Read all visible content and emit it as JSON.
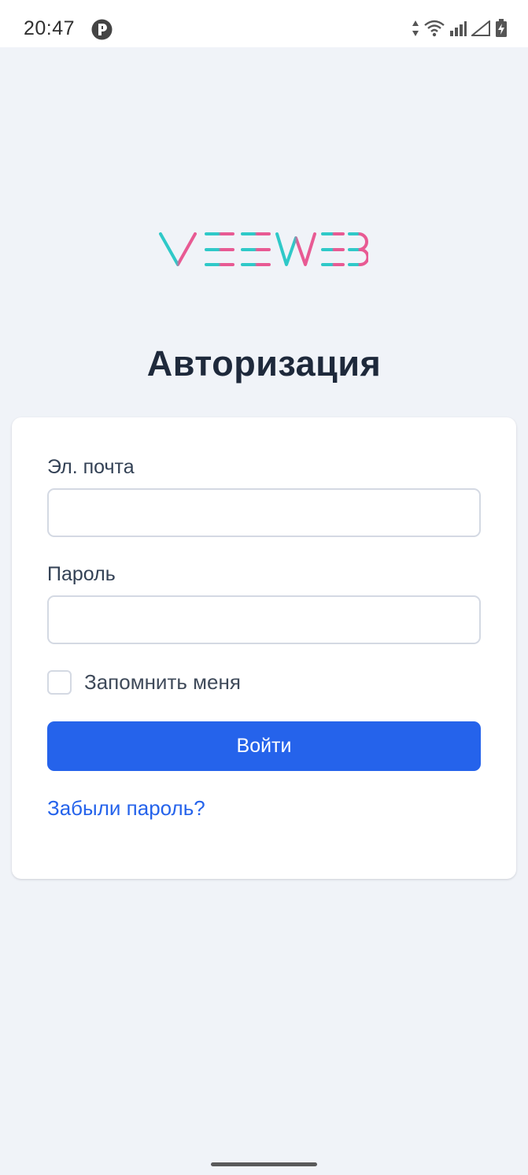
{
  "status_bar": {
    "time": "20:47",
    "app_icon": "pocket-p-icon",
    "icons": [
      "data-arrows-icon",
      "wifi-icon",
      "signal-icon",
      "signal-empty-icon",
      "battery-charging-icon"
    ]
  },
  "logo": {
    "text": "VEEWEB",
    "colors": {
      "start": "#2fc9c8",
      "end": "#e85a93"
    }
  },
  "page": {
    "title": "Авторизация"
  },
  "form": {
    "email_label": "Эл. почта",
    "email_value": "",
    "password_label": "Пароль",
    "password_value": "",
    "remember_label": "Запомнить меня",
    "remember_checked": false,
    "submit_label": "Войти",
    "forgot_link": "Забыли пароль?"
  },
  "colors": {
    "background": "#f0f3f8",
    "accent": "#2563eb",
    "card": "#ffffff"
  }
}
